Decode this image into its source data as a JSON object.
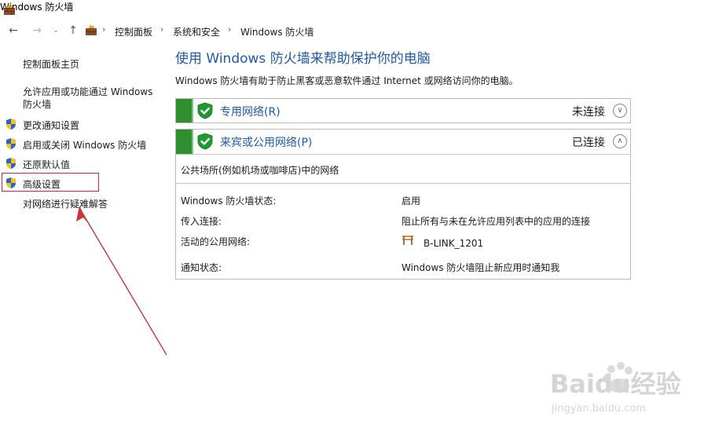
{
  "window": {
    "title": "Windows 防火墙"
  },
  "nav": {
    "breadcrumbs": [
      "控制面板",
      "系统和安全",
      "Windows 防火墙"
    ]
  },
  "sidebar": {
    "home": "控制面板主页",
    "allow_app": "允许应用或功能通过 Windows 防火墙",
    "notify": "更改通知设置",
    "toggle": "启用或关闭 Windows 防火墙",
    "restore": "还原默认值",
    "advanced": "高级设置",
    "troubleshoot": "对网络进行疑难解答"
  },
  "main": {
    "title": "使用 Windows 防火墙来帮助保护你的电脑",
    "description": "Windows 防火墙有助于防止黑客或恶意软件通过 Internet 或网络访问你的电脑。",
    "private": {
      "name": "专用网络(R)",
      "status": "未连接"
    },
    "public": {
      "name": "来宾或公用网络(P)",
      "status": "已连接",
      "desc": "公共场所(例如机场或咖啡店)中的网络",
      "rows": [
        {
          "label": "Windows 防火墙状态:",
          "value": "启用"
        },
        {
          "label": "传入连接:",
          "value": "阻止所有与未在允许应用列表中的应用的连接"
        },
        {
          "label": "活动的公用网络:",
          "value": "B-LINK_1201"
        },
        {
          "label": "通知状态:",
          "value": "Windows 防火墙阻止新应用时通知我"
        }
      ]
    }
  },
  "watermark": {
    "text": "Baidu经验",
    "sub": "jingyan.baidu.com"
  },
  "colors": {
    "link": "#1e5aa8",
    "green": "#2f8f2f",
    "annotation": "#d9242a"
  }
}
